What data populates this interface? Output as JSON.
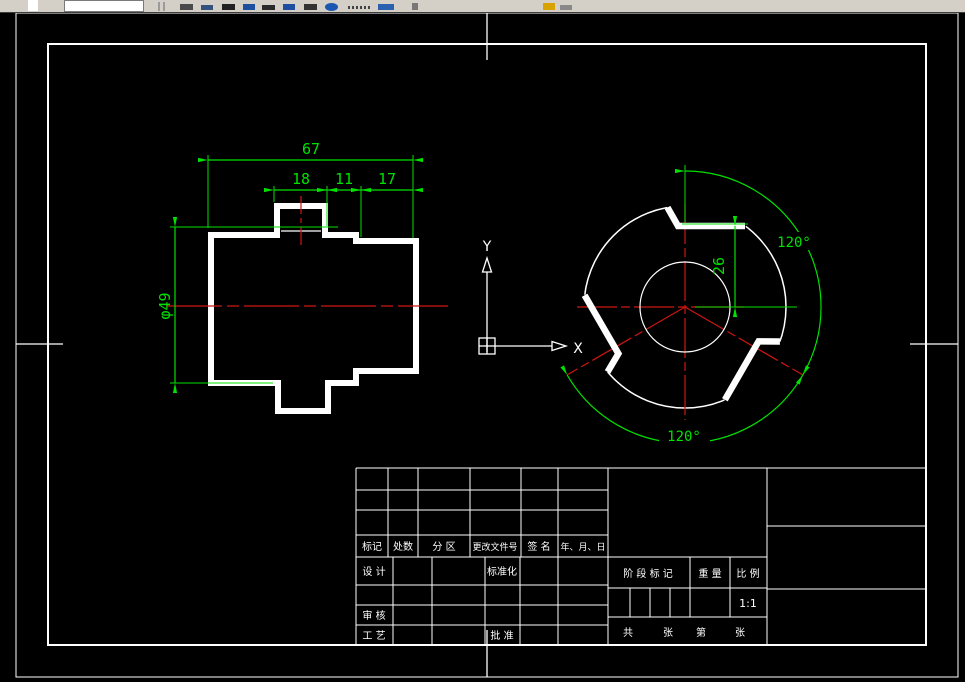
{
  "drawing": {
    "front_view": {
      "dim_total_width": "67",
      "dim_seg1": "18",
      "dim_seg2": "11",
      "dim_seg3": "17",
      "dim_diameter": "φ49"
    },
    "side_view": {
      "dim_depth": "26",
      "dim_angle_top": "120°",
      "dim_angle_bottom": "120°"
    },
    "ucs": {
      "x_label": "X",
      "y_label": "Y"
    },
    "title_block": {
      "rev_headers": [
        "标记",
        "处数",
        "分 区",
        "更改文件号",
        "签 名",
        "年、月、日"
      ],
      "design": "设 计",
      "standardization": "标准化",
      "check": "审 核",
      "process": "工 艺",
      "approve": "批 准",
      "stage_mark": "阶 段 标 记",
      "weight": "重 量",
      "scale_label": "比 例",
      "scale_value": "1:1",
      "sheets_total_label": "共",
      "sheets_total_unit": "张",
      "sheet_no_label": "第",
      "sheet_no_unit": "张"
    },
    "colors": {
      "dimension_green": "#00e100",
      "centerline_red": "#cd1612",
      "geometry_white": "#ffffff",
      "paper_black": "#000000",
      "toolbar_gray": "#d4d0c8"
    }
  }
}
